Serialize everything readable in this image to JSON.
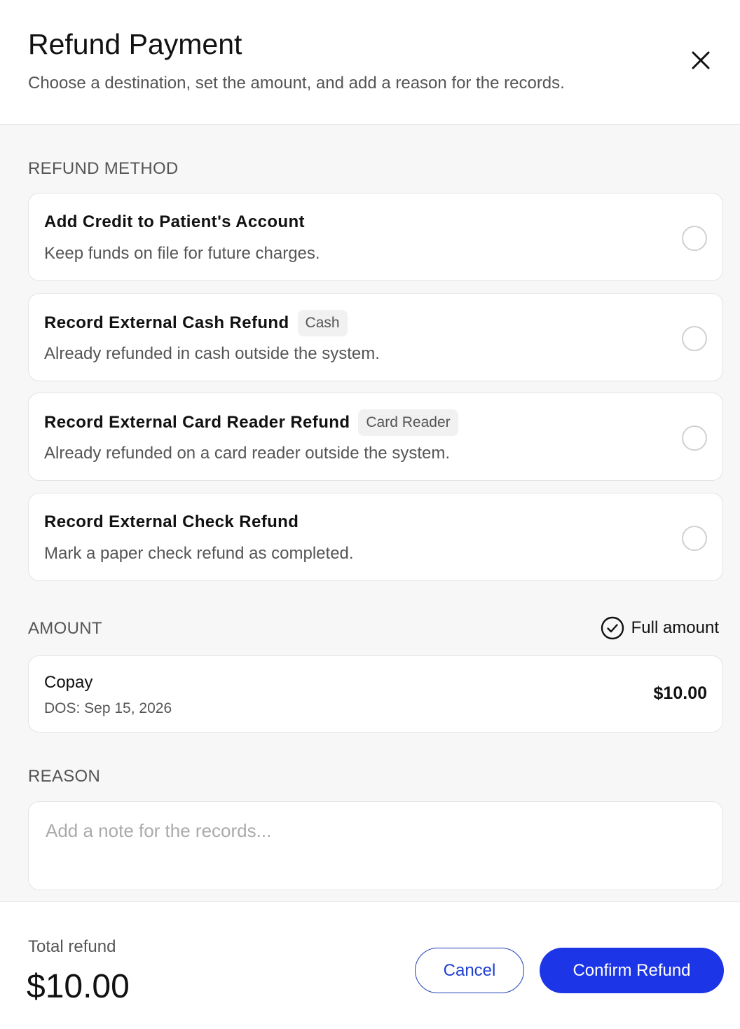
{
  "header": {
    "title": "Refund Payment",
    "subtitle": "Choose a destination, set the amount, and add a reason for the records."
  },
  "refund_method": {
    "label": "REFUND METHOD",
    "options": [
      {
        "title": "Add Credit to Patient's Account",
        "badge": "",
        "description": "Keep funds on file for future charges.",
        "selected": false
      },
      {
        "title": "Record External Cash Refund",
        "badge": "Cash",
        "description": "Already refunded in cash outside the system.",
        "selected": false
      },
      {
        "title": "Record External Card Reader Refund",
        "badge": "Card Reader",
        "description": "Already refunded on a card reader outside the system.",
        "selected": false
      },
      {
        "title": "Record External Check Refund",
        "badge": "",
        "description": "Mark a paper check refund as completed.",
        "selected": false
      }
    ]
  },
  "amount": {
    "label": "AMOUNT",
    "full_amount_label": "Full amount",
    "full_amount_checked": true,
    "item": {
      "name": "Copay",
      "dos": "DOS: Sep 15, 2026",
      "value": "$10.00"
    }
  },
  "reason": {
    "label": "REASON",
    "placeholder": "Add a note for the records...",
    "value": ""
  },
  "footer": {
    "total_label": "Total refund",
    "total_value": "$10.00",
    "cancel_label": "Cancel",
    "confirm_label": "Confirm Refund"
  },
  "colors": {
    "primary": "#1c35e6",
    "background": "#f7f7f7",
    "card": "#ffffff",
    "muted_text": "#555555"
  },
  "icons": {
    "close": "close-icon",
    "full_amount": "check-circle-icon"
  }
}
